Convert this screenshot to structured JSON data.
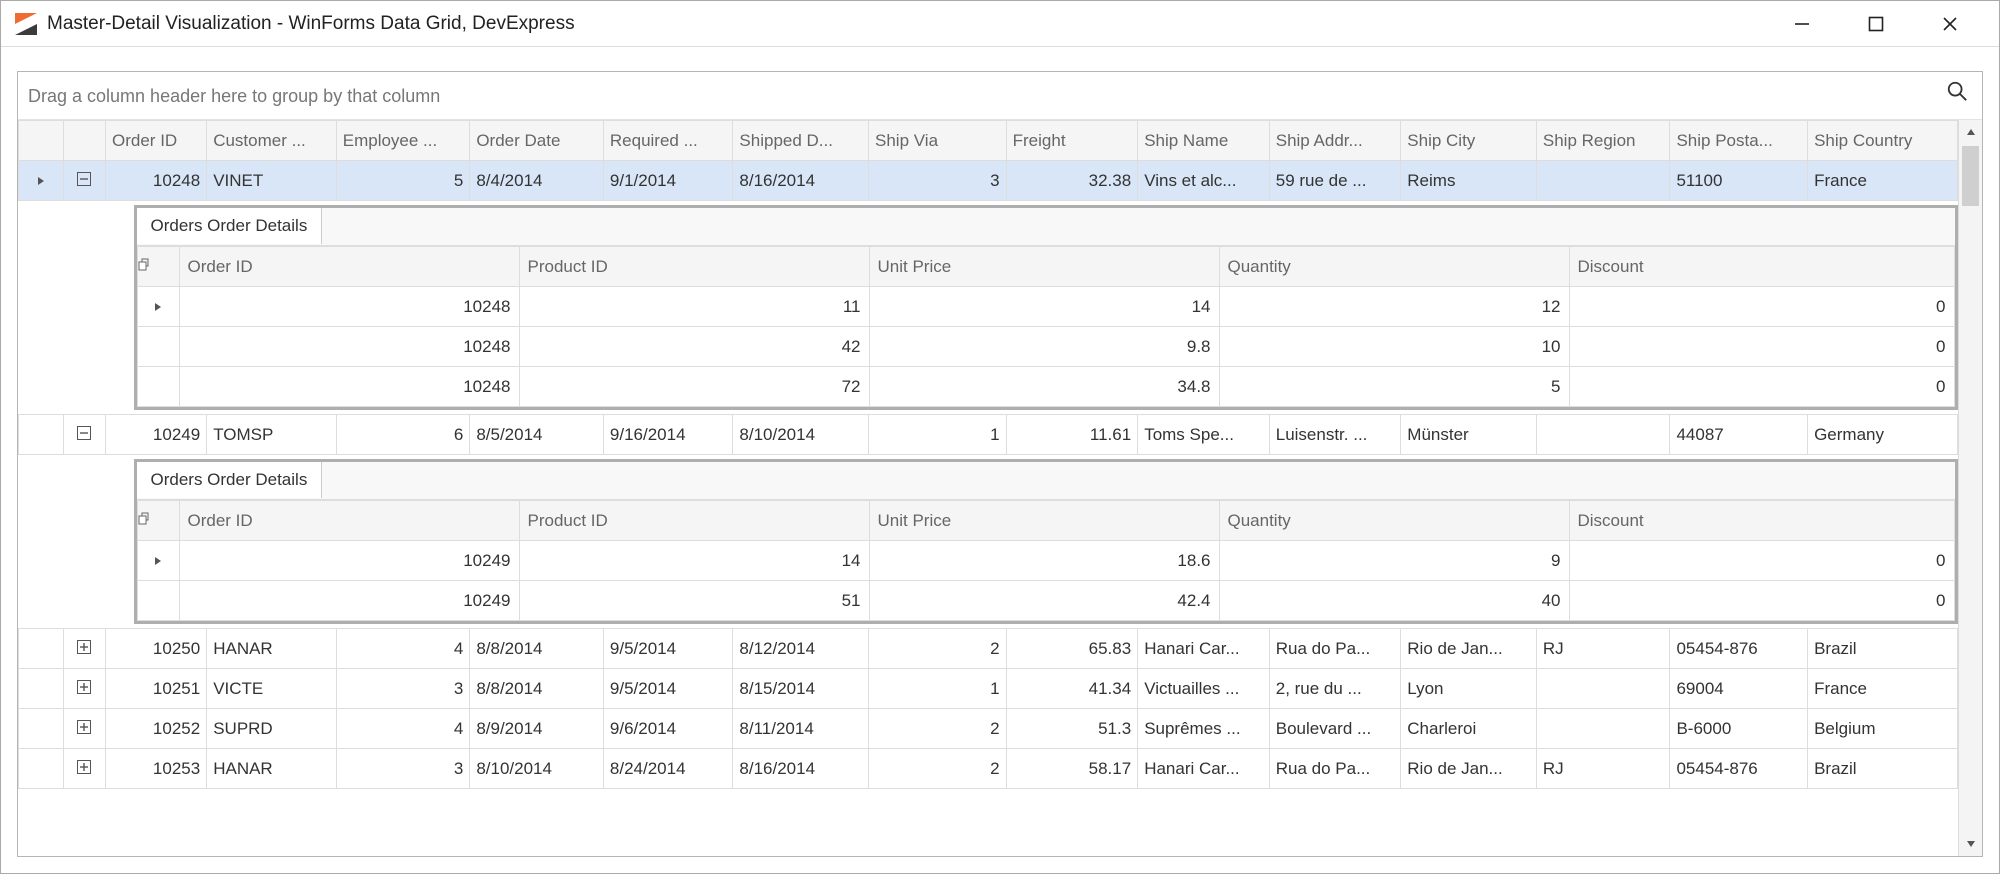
{
  "window": {
    "title": "Master-Detail Visualization - WinForms Data Grid, DevExpress"
  },
  "groupPanel": {
    "text": "Drag a column header here to group by that column"
  },
  "columns": {
    "orderId": "Order ID",
    "customerId": "Customer ...",
    "employeeId": "Employee ...",
    "orderDate": "Order Date",
    "requiredDate": "Required ...",
    "shippedDate": "Shipped D...",
    "shipVia": "Ship Via",
    "freight": "Freight",
    "shipName": "Ship Name",
    "shipAddress": "Ship Addr...",
    "shipCity": "Ship City",
    "shipRegion": "Ship Region",
    "shipPostal": "Ship Posta...",
    "shipCountry": "Ship Country"
  },
  "detail": {
    "tab": "Orders Order Details",
    "columns": {
      "orderId": "Order ID",
      "productId": "Product ID",
      "unitPrice": "Unit Price",
      "quantity": "Quantity",
      "discount": "Discount"
    }
  },
  "rows": [
    {
      "expanded": true,
      "selected": true,
      "focused": true,
      "orderId": "10248",
      "customerId": "VINET",
      "employeeId": "5",
      "orderDate": "8/4/2014",
      "requiredDate": "9/1/2014",
      "shippedDate": "8/16/2014",
      "shipVia": "3",
      "freight": "32.38",
      "shipName": "Vins et alc...",
      "shipAddress": "59 rue de ...",
      "shipCity": "Reims",
      "shipRegion": "",
      "shipPostal": "51100",
      "shipCountry": "France",
      "details": [
        {
          "focused": true,
          "orderId": "10248",
          "productId": "11",
          "unitPrice": "14",
          "quantity": "12",
          "discount": "0"
        },
        {
          "orderId": "10248",
          "productId": "42",
          "unitPrice": "9.8",
          "quantity": "10",
          "discount": "0"
        },
        {
          "orderId": "10248",
          "productId": "72",
          "unitPrice": "34.8",
          "quantity": "5",
          "discount": "0"
        }
      ]
    },
    {
      "expanded": true,
      "orderId": "10249",
      "customerId": "TOMSP",
      "employeeId": "6",
      "orderDate": "8/5/2014",
      "requiredDate": "9/16/2014",
      "shippedDate": "8/10/2014",
      "shipVia": "1",
      "freight": "11.61",
      "shipName": "Toms Spe...",
      "shipAddress": "Luisenstr. ...",
      "shipCity": "Münster",
      "shipRegion": "",
      "shipPostal": "44087",
      "shipCountry": "Germany",
      "details": [
        {
          "focused": true,
          "orderId": "10249",
          "productId": "14",
          "unitPrice": "18.6",
          "quantity": "9",
          "discount": "0"
        },
        {
          "orderId": "10249",
          "productId": "51",
          "unitPrice": "42.4",
          "quantity": "40",
          "discount": "0"
        }
      ]
    },
    {
      "expanded": false,
      "orderId": "10250",
      "customerId": "HANAR",
      "employeeId": "4",
      "orderDate": "8/8/2014",
      "requiredDate": "9/5/2014",
      "shippedDate": "8/12/2014",
      "shipVia": "2",
      "freight": "65.83",
      "shipName": "Hanari Car...",
      "shipAddress": "Rua do Pa...",
      "shipCity": "Rio de Jan...",
      "shipRegion": "RJ",
      "shipPostal": "05454-876",
      "shipCountry": "Brazil"
    },
    {
      "expanded": false,
      "orderId": "10251",
      "customerId": "VICTE",
      "employeeId": "3",
      "orderDate": "8/8/2014",
      "requiredDate": "9/5/2014",
      "shippedDate": "8/15/2014",
      "shipVia": "1",
      "freight": "41.34",
      "shipName": "Victuailles ...",
      "shipAddress": "2, rue du ...",
      "shipCity": "Lyon",
      "shipRegion": "",
      "shipPostal": "69004",
      "shipCountry": "France"
    },
    {
      "expanded": false,
      "orderId": "10252",
      "customerId": "SUPRD",
      "employeeId": "4",
      "orderDate": "8/9/2014",
      "requiredDate": "9/6/2014",
      "shippedDate": "8/11/2014",
      "shipVia": "2",
      "freight": "51.3",
      "shipName": "Suprêmes ...",
      "shipAddress": "Boulevard ...",
      "shipCity": "Charleroi",
      "shipRegion": "",
      "shipPostal": "B-6000",
      "shipCountry": "Belgium"
    },
    {
      "expanded": false,
      "orderId": "10253",
      "customerId": "HANAR",
      "employeeId": "3",
      "orderDate": "8/10/2014",
      "requiredDate": "8/24/2014",
      "shippedDate": "8/16/2014",
      "shipVia": "2",
      "freight": "58.17",
      "shipName": "Hanari Car...",
      "shipAddress": "Rua do Pa...",
      "shipCity": "Rio de Jan...",
      "shipRegion": "RJ",
      "shipPostal": "05454-876",
      "shipCountry": "Brazil"
    }
  ]
}
